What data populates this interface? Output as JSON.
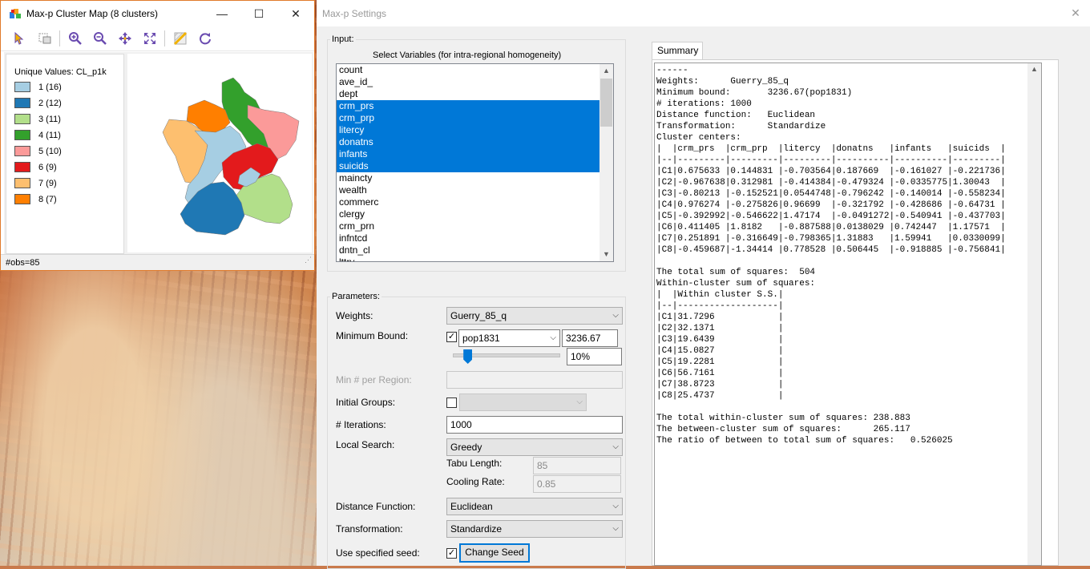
{
  "map_window": {
    "title": "Max-p Cluster Map (8 clusters)",
    "controls": {
      "minimize": "—",
      "maximize": "☐",
      "close": "✕"
    },
    "toolbar": [
      "select-tool",
      "selection-mode",
      "zoom-in",
      "zoom-out",
      "pan",
      "fit-to-window",
      "map-theme",
      "refresh"
    ],
    "legend": {
      "header": "Unique Values: CL_p1k",
      "items": [
        {
          "label": "1 (16)",
          "color": "#a6cee3"
        },
        {
          "label": "2 (12)",
          "color": "#1f78b4"
        },
        {
          "label": "3 (11)",
          "color": "#b2df8a"
        },
        {
          "label": "4 (11)",
          "color": "#33a02c"
        },
        {
          "label": "5 (10)",
          "color": "#fb9a99"
        },
        {
          "label": "6 (9)",
          "color": "#e31a1c"
        },
        {
          "label": "7 (9)",
          "color": "#fdbf6f"
        },
        {
          "label": "8 (7)",
          "color": "#ff7f00"
        }
      ]
    },
    "status": "#obs=85"
  },
  "settings": {
    "title": "Max-p Settings",
    "close": "✕",
    "input": {
      "group_label": "Input:",
      "list_title": "Select Variables (for intra-regional homogeneity)",
      "variables": [
        {
          "name": "count",
          "selected": false
        },
        {
          "name": "ave_id_",
          "selected": false
        },
        {
          "name": "dept",
          "selected": false
        },
        {
          "name": "crm_prs",
          "selected": true
        },
        {
          "name": "crm_prp",
          "selected": true
        },
        {
          "name": "litercy",
          "selected": true
        },
        {
          "name": "donatns",
          "selected": true
        },
        {
          "name": "infants",
          "selected": true
        },
        {
          "name": "suicids",
          "selected": true
        },
        {
          "name": "maincty",
          "selected": false
        },
        {
          "name": "wealth",
          "selected": false
        },
        {
          "name": "commerc",
          "selected": false
        },
        {
          "name": "clergy",
          "selected": false
        },
        {
          "name": "crm_prn",
          "selected": false
        },
        {
          "name": "infntcd",
          "selected": false
        },
        {
          "name": "dntn_cl",
          "selected": false
        },
        {
          "name": "lttry",
          "selected": false
        }
      ]
    },
    "parameters": {
      "group_label": "Parameters:",
      "weights_label": "Weights:",
      "weights_value": "Guerry_85_q",
      "min_bound_label": "Minimum Bound:",
      "min_bound_checked": "✓",
      "min_bound_var": "pop1831",
      "min_bound_value": "3236.67",
      "min_bound_pct": "10%",
      "min_bound_slider": 0.1,
      "min_region_label": "Min # per Region:",
      "min_region_value": "",
      "initial_groups_label": "Initial Groups:",
      "initial_groups_checked": "",
      "initial_groups_value": "",
      "iterations_label": "# Iterations:",
      "iterations_value": "1000",
      "local_search_label": "Local Search:",
      "local_search_value": "Greedy",
      "tabu_label": "Tabu Length:",
      "tabu_value": "85",
      "cooling_label": "Cooling Rate:",
      "cooling_value": "0.85",
      "distance_label": "Distance Function:",
      "distance_value": "Euclidean",
      "transform_label": "Transformation:",
      "transform_value": "Standardize",
      "seed_label": "Use specified seed:",
      "seed_checked": "✓",
      "change_seed_label": "Change Seed"
    },
    "summary": {
      "tab_label": "Summary",
      "text": "------\nWeights:      Guerry_85_q\nMinimum bound:       3236.67(pop1831)\n# iterations: 1000\nDistance function:   Euclidean\nTransformation:      Standardize\nCluster centers:\n|  |crm_prs  |crm_prp  |litercy  |donatns   |infants   |suicids  |\n|--|---------|---------|---------|----------|----------|---------|\n|C1|0.675633 |0.144831 |-0.703564|0.187669  |-0.161027 |-0.221736|\n|C2|-0.967638|0.312981 |-0.414384|-0.479324 |-0.0335775|1.30043  |\n|C3|-0.80213 |-0.152521|0.0544748|-0.796242 |-0.140014 |-0.558234|\n|C4|0.976274 |-0.275826|0.96699  |-0.321792 |-0.428686 |-0.64731 |\n|C5|-0.392992|-0.546622|1.47174  |-0.0491272|-0.540941 |-0.437703|\n|C6|0.411405 |1.8182   |-0.887588|0.0138029 |0.742447  |1.17571  |\n|C7|0.251891 |-0.316649|-0.798365|1.31883   |1.59941   |0.0330099|\n|C8|-0.459687|-1.34414 |0.778528 |0.506445  |-0.918885 |-0.756841|\n\nThe total sum of squares:  504\nWithin-cluster sum of squares:\n|  |Within cluster S.S.|\n|--|-------------------|\n|C1|31.7296            |\n|C2|32.1371            |\n|C3|19.6439            |\n|C4|15.0827            |\n|C5|19.2281            |\n|C6|56.7161            |\n|C7|38.8723            |\n|C8|25.4737            |\n\nThe total within-cluster sum of squares: 238.883\nThe between-cluster sum of squares:      265.117\nThe ratio of between to total sum of squares:   0.526025"
    }
  }
}
